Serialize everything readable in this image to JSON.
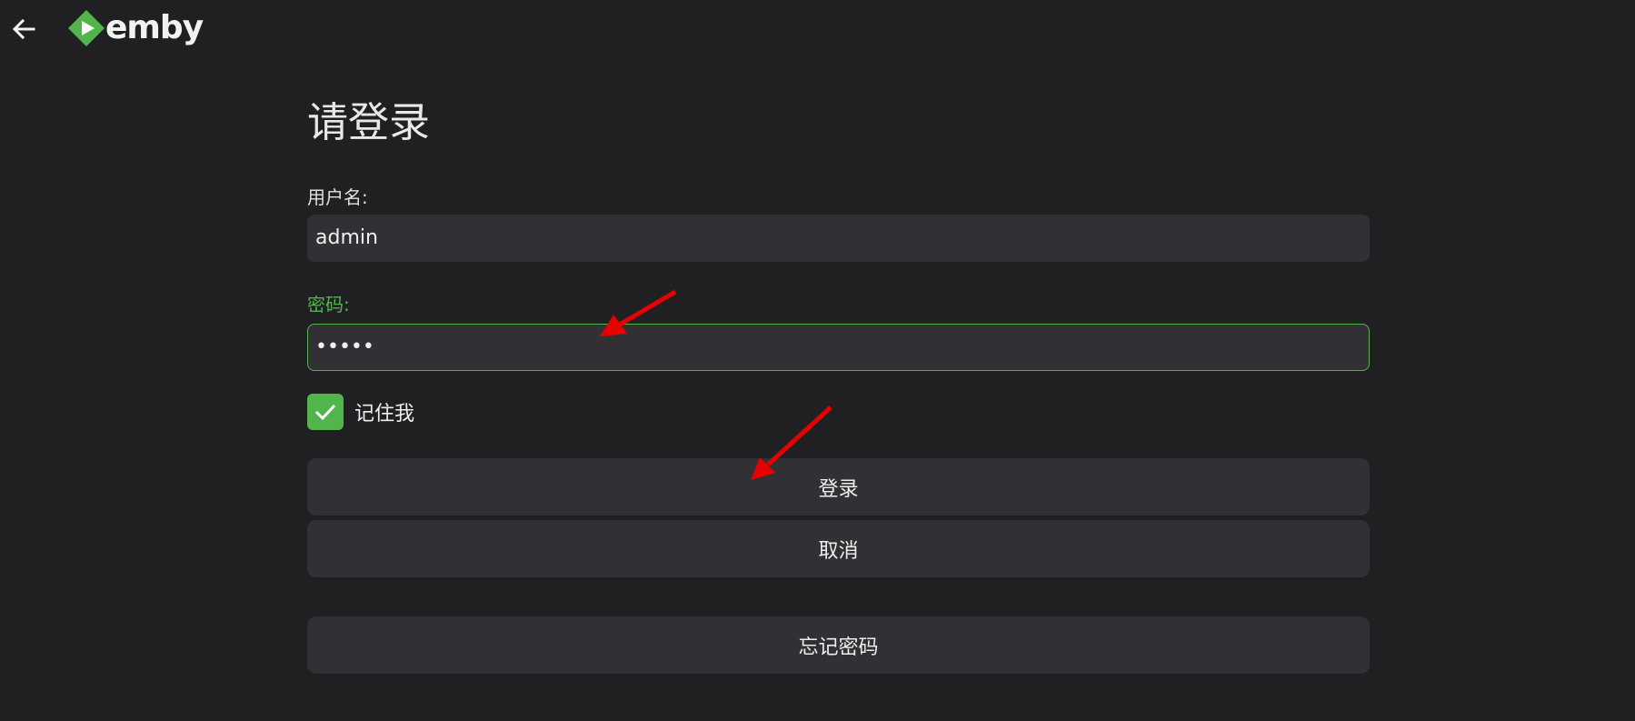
{
  "header": {
    "back_icon": "arrow-left-icon",
    "logo_text": "emby",
    "brand_color": "#52b54b"
  },
  "form": {
    "title": "请登录",
    "username_label": "用户名:",
    "username_value": "admin",
    "password_label": "密码:",
    "password_value": "•••••",
    "remember_label": "记住我",
    "remember_checked": true,
    "sign_in_label": "登录",
    "cancel_label": "取消",
    "forgot_label": "忘记密码"
  },
  "colors": {
    "background": "#201f22",
    "input_bg": "#323034",
    "accent": "#52b54b",
    "annotation": "#e60000"
  }
}
